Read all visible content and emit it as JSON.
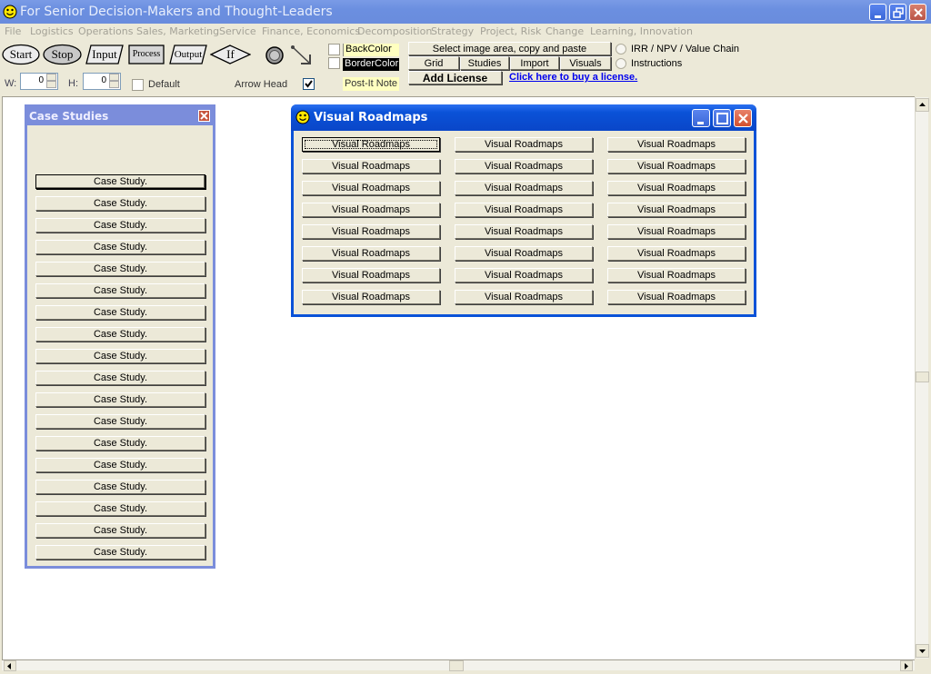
{
  "window": {
    "title": "For Senior Decision-Makers and Thought-Leaders",
    "icon": "smiley-icon",
    "controls": [
      "minimize-icon",
      "restore-icon",
      "close-icon"
    ]
  },
  "menu": [
    "File",
    "Logistics",
    "Operations",
    "Sales, Marketing",
    "Service",
    "Finance, Economics",
    "Decomposition",
    "Strategy",
    "Project, Risk",
    "Change",
    "Learning, Innovation"
  ],
  "toolbar": {
    "shapes": [
      "Start",
      "Stop",
      "Input",
      "Process",
      "Output",
      "If"
    ],
    "shape_icons": [
      "circle-target-icon",
      "arrow-icon"
    ],
    "w_label": "W:",
    "w_value": "0",
    "h_label": "H:",
    "h_value": "0",
    "default_label": "Default",
    "default_checked": false,
    "arrow_head_label": "Arrow Head",
    "arrow_head_checked": true,
    "back_color_label": "BackColor",
    "border_color_label": "BorderColor",
    "post_it_label": "Post-It Note",
    "select_image_label": "Select image area, copy and paste",
    "grid_label": "Grid",
    "studies_label": "Studies",
    "import_label": "Import",
    "visuals_label": "Visuals",
    "add_license_label": "Add License",
    "buy_link": "Click here to buy a license.",
    "radio_irr": "IRR / NPV / Value Chain",
    "radio_instructions": "Instructions"
  },
  "case_studies": {
    "title": "Case Studies",
    "items": [
      "Case Study.",
      "Case Study.",
      "Case Study.",
      "Case Study.",
      "Case Study.",
      "Case Study.",
      "Case Study.",
      "Case Study.",
      "Case Study.",
      "Case Study.",
      "Case Study.",
      "Case Study.",
      "Case Study.",
      "Case Study.",
      "Case Study.",
      "Case Study.",
      "Case Study.",
      "Case Study."
    ]
  },
  "visual_roadmaps": {
    "title": "Visual Roadmaps",
    "buttons": [
      [
        "Visual Roadmaps",
        "Visual Roadmaps",
        "Visual Roadmaps"
      ],
      [
        "Visual Roadmaps",
        "Visual Roadmaps",
        "Visual Roadmaps"
      ],
      [
        "Visual Roadmaps",
        "Visual Roadmaps",
        "Visual Roadmaps"
      ],
      [
        "Visual Roadmaps",
        "Visual Roadmaps",
        "Visual Roadmaps"
      ],
      [
        "Visual Roadmaps",
        "Visual Roadmaps",
        "Visual Roadmaps"
      ],
      [
        "Visual Roadmaps",
        "Visual Roadmaps",
        "Visual Roadmaps"
      ],
      [
        "Visual Roadmaps",
        "Visual Roadmaps",
        "Visual Roadmaps"
      ],
      [
        "Visual Roadmaps",
        "Visual Roadmaps",
        "Visual Roadmaps"
      ]
    ]
  },
  "colors": {
    "titlebar": "#6b8fe0",
    "dialog_titlebar": "#0a52d8",
    "panel_border": "#7b8ddb",
    "face": "#ece9d8",
    "post_it": "#ffffc0",
    "link": "#0000ee"
  }
}
